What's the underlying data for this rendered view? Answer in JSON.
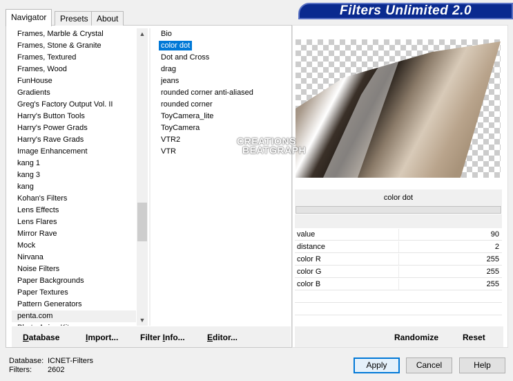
{
  "tabs": [
    {
      "label": "Navigator",
      "active": true
    },
    {
      "label": "Presets",
      "active": false
    },
    {
      "label": "About",
      "active": false
    }
  ],
  "title": "Filters Unlimited 2.0",
  "categories": [
    "Frames, Marble & Crystal",
    "Frames, Stone & Granite",
    "Frames, Textured",
    "Frames, Wood",
    "FunHouse",
    "Gradients",
    "Greg's Factory Output Vol. II",
    "Harry's Button Tools",
    "Harry's Power Grads",
    "Harry's Rave Grads",
    "Image Enhancement",
    "kang 1",
    "kang 3",
    "kang",
    "Kohan's Filters",
    "Lens Effects",
    "Lens Flares",
    "Mirror Rave",
    "Mock",
    "Nirvana",
    "Noise Filters",
    "Paper Backgrounds",
    "Paper Textures",
    "Pattern Generators",
    "penta.com",
    "Photo Aging Kit"
  ],
  "current_category": "penta.com",
  "filters": [
    "Bio",
    "color dot",
    "Dot and Cross",
    "drag",
    "jeans",
    "rounded corner anti-aliased",
    "rounded corner",
    "ToyCamera_lite",
    "ToyCamera",
    "VTR2",
    "VTR"
  ],
  "selected_filter": "color dot",
  "list_buttons": {
    "database": {
      "first": "D",
      "rest": "atabase"
    },
    "import": {
      "first": "I",
      "rest": "mport..."
    },
    "filter_info": {
      "lead": "Filter ",
      "first": "I",
      "rest": "nfo..."
    },
    "editor": {
      "first": "E",
      "rest": "ditor..."
    }
  },
  "watermark": {
    "line1": "CREATIONS",
    "line2": "BEATGRAPH"
  },
  "filter_name": "color dot",
  "params": [
    {
      "label": "value",
      "value": "90"
    },
    {
      "label": "distance",
      "value": "2"
    },
    {
      "label": "color R",
      "value": "255"
    },
    {
      "label": "color G",
      "value": "255"
    },
    {
      "label": "color B",
      "value": "255"
    }
  ],
  "right_buttons": {
    "randomize": "Randomize",
    "reset": "Reset"
  },
  "status": {
    "database_label": "Database:",
    "database_value": "ICNET-Filters",
    "filters_label": "Filters:",
    "filters_value": "2602"
  },
  "dialog_buttons": {
    "apply": "Apply",
    "cancel": "Cancel",
    "help": "Help"
  },
  "colors": {
    "banner": "#0a2a8f",
    "selection": "#0078d7"
  }
}
